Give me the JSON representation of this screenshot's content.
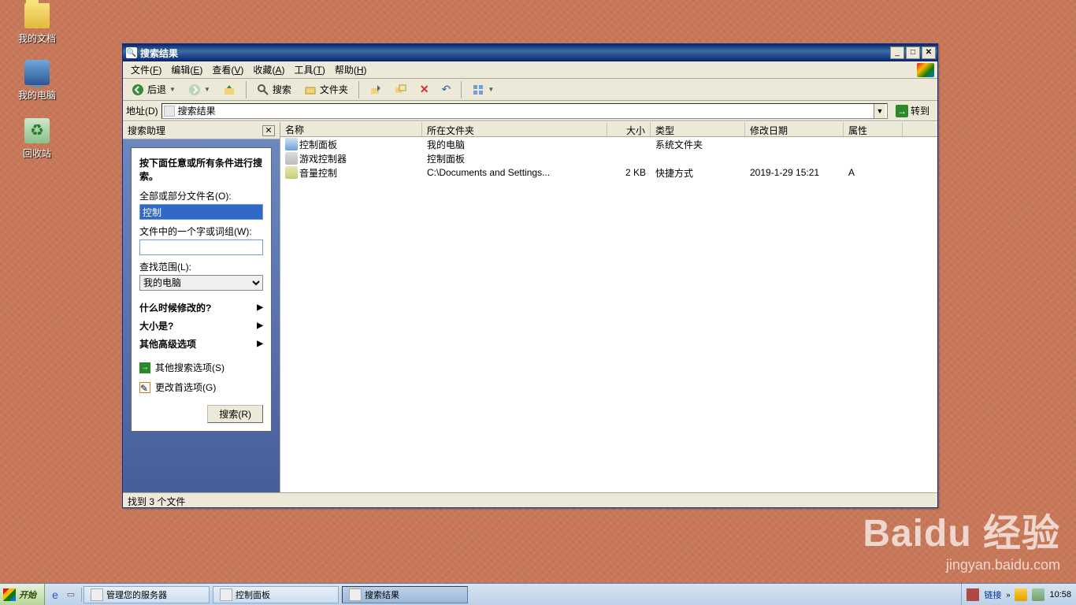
{
  "desktop": {
    "icons": [
      {
        "label": "我的文档"
      },
      {
        "label": "我的电脑"
      },
      {
        "label": "回收站"
      }
    ]
  },
  "window": {
    "title": "搜索结果",
    "menus": [
      {
        "label": "文件",
        "hotkey": "F"
      },
      {
        "label": "编辑",
        "hotkey": "E"
      },
      {
        "label": "查看",
        "hotkey": "V"
      },
      {
        "label": "收藏",
        "hotkey": "A"
      },
      {
        "label": "工具",
        "hotkey": "T"
      },
      {
        "label": "帮助",
        "hotkey": "H"
      }
    ],
    "toolbar": {
      "back": "后退",
      "search": "搜索",
      "folders": "文件夹"
    },
    "address": {
      "label": "地址(D)",
      "value": "搜索结果",
      "go": "转到"
    },
    "sidebar": {
      "title": "搜索助理",
      "heading": "按下面任意或所有条件进行搜索。",
      "filename_label": "全部或部分文件名(O):",
      "filename_value": "控制",
      "phrase_label": "文件中的一个字或词组(W):",
      "phrase_value": "",
      "lookin_label": "查找范围(L):",
      "lookin_value": "我的电脑",
      "expanders": [
        "什么时候修改的?",
        "大小是?",
        "其他高级选项"
      ],
      "other_options": "其他搜索选项(S)",
      "change_prefs": "更改首选项(G)",
      "search_btn": "搜索(R)"
    },
    "columns": {
      "name": "名称",
      "folder": "所在文件夹",
      "size": "大小",
      "type": "类型",
      "date": "修改日期",
      "attr": "属性"
    },
    "rows": [
      {
        "name": "控制面板",
        "folder": "我的电脑",
        "size": "",
        "type": "系统文件夹",
        "date": "",
        "attr": "",
        "icon": "ico-cp"
      },
      {
        "name": "游戏控制器",
        "folder": "控制面板",
        "size": "",
        "type": "",
        "date": "",
        "attr": "",
        "icon": "ico-joy"
      },
      {
        "name": "音量控制",
        "folder": "C:\\Documents and Settings...",
        "size": "2 KB",
        "type": "快捷方式",
        "date": "2019-1-29 15:21",
        "attr": "A",
        "icon": "ico-vol"
      }
    ],
    "status": "找到 3 个文件"
  },
  "taskbar": {
    "start": "开始",
    "buttons": [
      {
        "label": "管理您的服务器",
        "active": false
      },
      {
        "label": "控制面板",
        "active": false
      },
      {
        "label": "搜索结果",
        "active": true
      }
    ],
    "tray_link": "链接",
    "clock": "10:58"
  },
  "watermark": {
    "big": "Baidu 经验",
    "small": "jingyan.baidu.com"
  }
}
